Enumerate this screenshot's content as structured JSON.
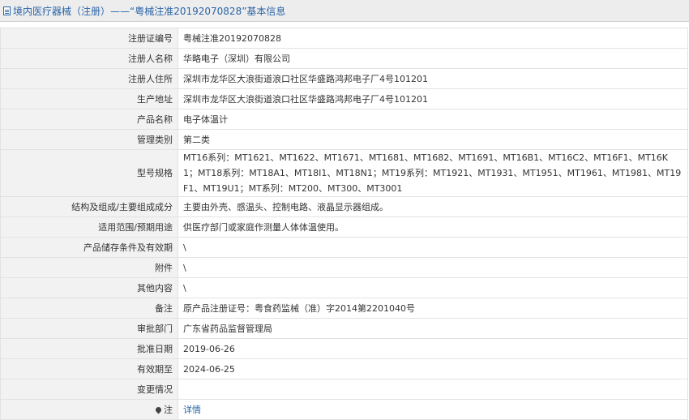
{
  "header": {
    "title": "境内医疗器械（注册）——“粤械注准20192070828”基本信息",
    "icon": "document-icon"
  },
  "rows": [
    {
      "label": "注册证编号",
      "value": "粤械注准20192070828"
    },
    {
      "label": "注册人名称",
      "value": "华略电子（深圳）有限公司"
    },
    {
      "label": "注册人住所",
      "value": "深圳市龙华区大浪街道浪口社区华盛路鸿邦电子厂4号101201"
    },
    {
      "label": "生产地址",
      "value": "深圳市龙华区大浪街道浪口社区华盛路鸿邦电子厂4号101201"
    },
    {
      "label": "产品名称",
      "value": "电子体温计"
    },
    {
      "label": "管理类别",
      "value": "第二类"
    },
    {
      "label": "型号规格",
      "value": "MT16系列：MT1621、MT1622、MT1671、MT1681、MT1682、MT1691、MT16B1、MT16C2、MT16F1、MT16K1；MT18系列：MT18A1、MT18I1、MT18N1；MT19系列：MT1921、MT1931、MT1951、MT1961、MT1981、MT19F1、MT19U1；MT系列：MT200、MT300、MT3001"
    },
    {
      "label": "结构及组成/主要组成成分",
      "value": "主要由外壳、感温头、控制电路、液晶显示器组成。"
    },
    {
      "label": "适用范围/预期用途",
      "value": "供医疗部门或家庭作测量人体体温使用。"
    },
    {
      "label": "产品储存条件及有效期",
      "value": "\\"
    },
    {
      "label": "附件",
      "value": "\\"
    },
    {
      "label": "其他内容",
      "value": "\\"
    },
    {
      "label": "备注",
      "value": "原产品注册证号：粤食药监械（准）字2014第2201040号"
    },
    {
      "label": "审批部门",
      "value": "广东省药品监督管理局"
    },
    {
      "label": "批准日期",
      "value": "2019-06-26"
    },
    {
      "label": "有效期至",
      "value": "2024-06-25"
    },
    {
      "label": "变更情况",
      "value": ""
    }
  ],
  "note_row": {
    "label": "注",
    "link": "详情",
    "icon": "location-pin-icon"
  }
}
